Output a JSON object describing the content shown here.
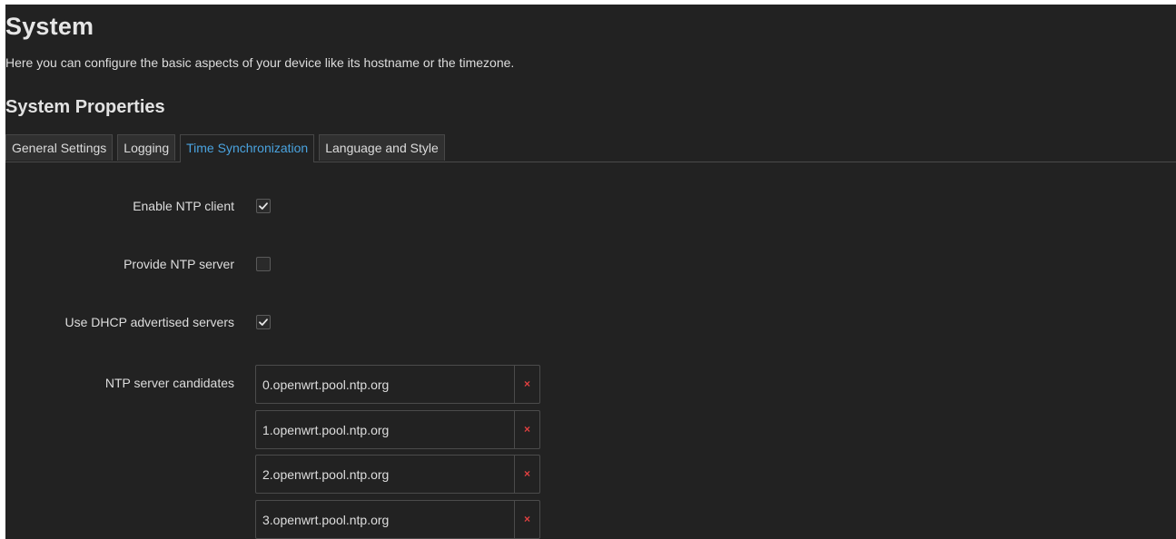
{
  "page": {
    "title": "System",
    "description": "Here you can configure the basic aspects of your device like its hostname or the timezone."
  },
  "section": {
    "title": "System Properties"
  },
  "tabs": [
    {
      "label": "General Settings",
      "active": false
    },
    {
      "label": "Logging",
      "active": false
    },
    {
      "label": "Time Synchronization",
      "active": true
    },
    {
      "label": "Language and Style",
      "active": false
    }
  ],
  "fields": {
    "enable_ntp_client": {
      "label": "Enable NTP client",
      "checked": true
    },
    "provide_ntp_server": {
      "label": "Provide NTP server",
      "checked": false
    },
    "use_dhcp_servers": {
      "label": "Use DHCP advertised servers",
      "checked": true
    },
    "ntp_candidates": {
      "label": "NTP server candidates",
      "remove_glyph": "×",
      "items": [
        "0.openwrt.pool.ntp.org",
        "1.openwrt.pool.ntp.org",
        "2.openwrt.pool.ntp.org",
        "3.openwrt.pool.ntp.org"
      ]
    }
  },
  "icons": {
    "checkmark": "check-icon",
    "remove": "remove-icon"
  },
  "colors": {
    "background": "#222222",
    "active_tab_text": "#4aa3df",
    "remove_icon": "#e04040"
  }
}
